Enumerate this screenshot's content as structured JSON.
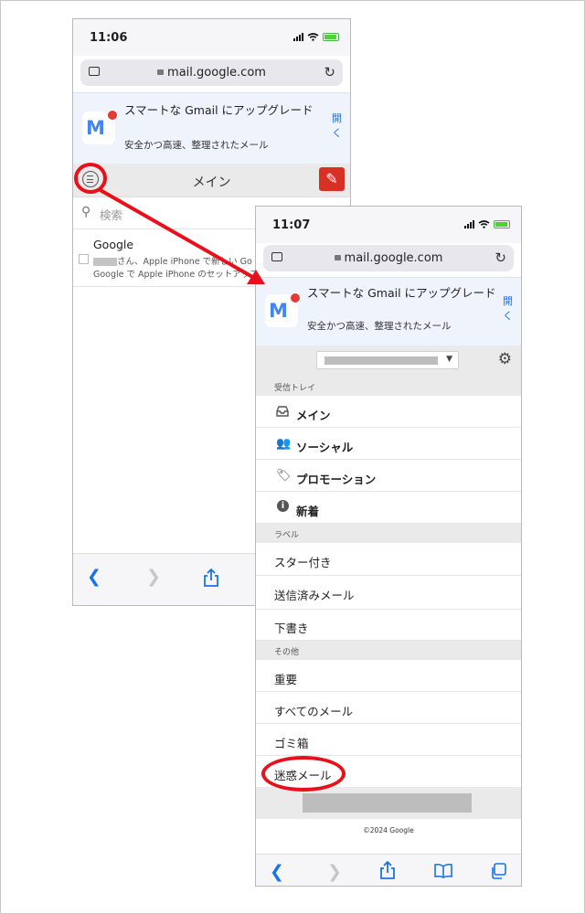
{
  "phone1": {
    "time": "11:06",
    "url": "mail.google.com",
    "banner": {
      "title": "スマートな Gmail にアップグレード",
      "subtitle": "安全かつ高速、整理されたメール",
      "open_label": "開く"
    },
    "header_title": "メイン",
    "search_placeholder": "検索",
    "mail": {
      "from": "Google",
      "line1": "さん、Apple iPhone で新しい Go",
      "line2": "Google で Apple iPhone のセットアップ"
    }
  },
  "phone2": {
    "time": "11:07",
    "url": "mail.google.com",
    "banner": {
      "title": "スマートな Gmail にアップグレード",
      "subtitle": "安全かつ高速、整理されたメール",
      "open_label": "開く"
    },
    "sections": {
      "inbox": "受信トレイ",
      "labels": "ラベル",
      "other": "その他"
    },
    "inbox_items": [
      "メイン",
      "ソーシャル",
      "プロモーション",
      "新着"
    ],
    "label_items": [
      "スター付き",
      "送信済みメール",
      "下書き"
    ],
    "other_items": [
      "重要",
      "すべてのメール",
      "ゴミ箱",
      "迷惑メール"
    ],
    "copyright": "©2024 Google"
  },
  "colors": {
    "accent_red": "#e8101a",
    "link_blue": "#1a73e8",
    "compose_red": "#d93025"
  },
  "icons": [
    "menu-icon",
    "compose-pencil-icon",
    "search-icon",
    "settings-gear-icon",
    "inbox-tray-icon",
    "people-icon",
    "tag-icon",
    "info-icon",
    "back-chevron-icon",
    "forward-chevron-icon",
    "share-icon",
    "bookmarks-icon",
    "tabs-icon",
    "reload-icon",
    "lock-icon"
  ]
}
